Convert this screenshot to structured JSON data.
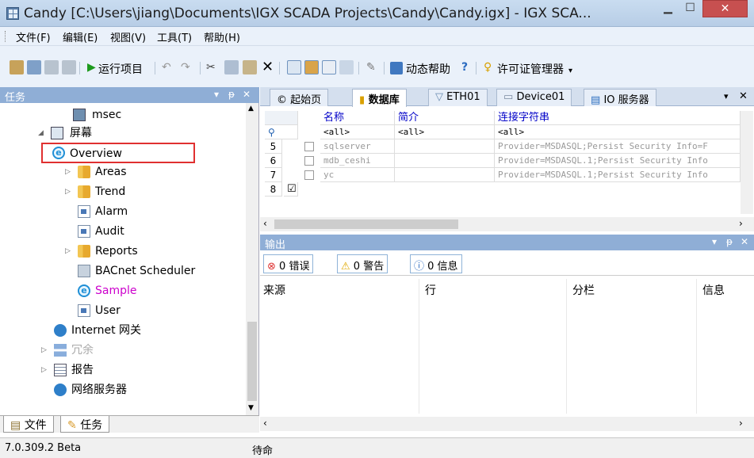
{
  "window": {
    "title": "Candy [C:\\Users\\jiang\\Documents\\IGX SCADA Projects\\Candy\\Candy.igx] - IGX SCA..."
  },
  "menubar": [
    "文件(F)",
    "编辑(E)",
    "视图(V)",
    "工具(T)",
    "帮助(H)"
  ],
  "toolbar": {
    "run_label": "运行项目",
    "dynamic_help_label": "动态帮助",
    "license_label": "许可证管理器"
  },
  "left_panel": {
    "title": "任务",
    "tree": [
      {
        "label": "msec",
        "icon": "screen-icon",
        "level": 3,
        "color": "#000000"
      },
      {
        "label": "屏幕",
        "icon": "screen-icon",
        "level": 2,
        "color": "#000000",
        "expanded": true
      },
      {
        "label": "Overview",
        "icon": "ie-icon",
        "level": 3,
        "color": "#000000",
        "highlighted": true
      },
      {
        "label": "Areas",
        "icon": "folder-icon",
        "level": 3,
        "color": "#000000"
      },
      {
        "label": "Trend",
        "icon": "folder-icon",
        "level": 3,
        "color": "#000000"
      },
      {
        "label": "Alarm",
        "icon": "doc-icon",
        "level": 3,
        "color": "#000000"
      },
      {
        "label": "Audit",
        "icon": "doc-icon",
        "level": 3,
        "color": "#000000"
      },
      {
        "label": "Reports",
        "icon": "folder-icon",
        "level": 3,
        "color": "#000000"
      },
      {
        "label": "BACnet Scheduler",
        "icon": "calendar-icon",
        "level": 3,
        "color": "#000000"
      },
      {
        "label": "Sample",
        "icon": "ie-icon",
        "level": 3,
        "color": "#cc00cc"
      },
      {
        "label": "User",
        "icon": "doc-icon",
        "level": 3,
        "color": "#000000"
      },
      {
        "label": "Internet 网关",
        "icon": "globe-icon",
        "level": 2,
        "color": "#000000"
      },
      {
        "label": "冗余",
        "icon": "network-icon",
        "level": 2,
        "color": "#aaaaaa"
      },
      {
        "label": "报告",
        "icon": "grid-icon",
        "level": 2,
        "color": "#000000"
      },
      {
        "label": "网络服务器",
        "icon": "globe-icon",
        "level": 2,
        "color": "#000000"
      }
    ],
    "tabs": [
      "文件",
      "任务"
    ]
  },
  "doc_tabs": [
    "起始页",
    "数据库",
    "ETH01",
    "Device01",
    "IO 服务器"
  ],
  "database_grid": {
    "columns": [
      "名称",
      "简介",
      "连接字符串"
    ],
    "filter": [
      "<all>",
      "<all>",
      "<all>"
    ],
    "rows": [
      {
        "num": "5",
        "name": "sqlserver",
        "desc": "",
        "conn": "Provider=MSDASQL;Persist Security Info=F",
        "checked": false
      },
      {
        "num": "6",
        "name": "mdb_ceshi",
        "desc": "",
        "conn": "Provider=MSDASQL.1;Persist Security Info",
        "checked": false
      },
      {
        "num": "7",
        "name": "yc",
        "desc": "",
        "conn": "Provider=MSDASQL.1;Persist Security Info",
        "checked": false
      },
      {
        "num": "8",
        "name": "",
        "desc": "",
        "conn": "",
        "checked": true
      }
    ]
  },
  "output": {
    "title": "输出",
    "errors": "0 错误",
    "warnings": "0 警告",
    "info": "0 信息",
    "columns": [
      "来源",
      "行",
      "分栏",
      "信息"
    ]
  },
  "statusbar": {
    "version": "7.0.309.2 Beta",
    "status": "待命"
  }
}
